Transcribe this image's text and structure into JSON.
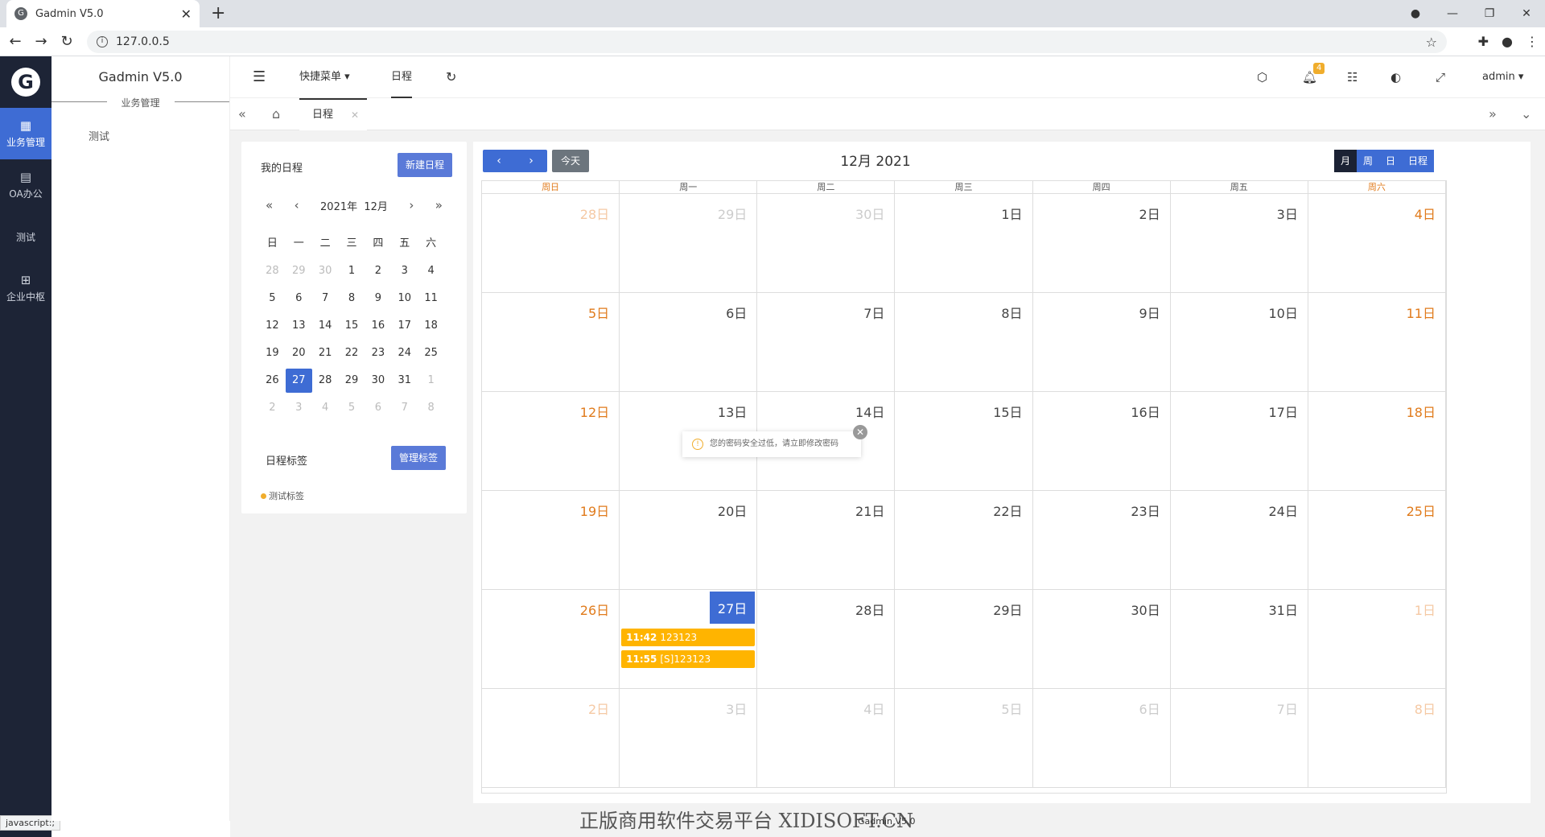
{
  "browser": {
    "tab_title": "Gadmin V5.0",
    "url": "127.0.0.5",
    "status_hint": "javascript:;"
  },
  "sidebar": {
    "items": [
      {
        "icon": "grid-icon",
        "label": "业务管理",
        "active": true
      },
      {
        "icon": "document-icon",
        "label": "OA办公"
      },
      {
        "icon": "none",
        "label": "测试"
      },
      {
        "icon": "apps-icon",
        "label": "企业中枢"
      }
    ]
  },
  "submenu": {
    "app_name": "Gadmin V5.0",
    "section": "业务管理",
    "items": [
      "测试"
    ]
  },
  "topbar": {
    "quick_menu": "快捷菜单",
    "schedule": "日程",
    "notification_count": "4",
    "user": "admin"
  },
  "tabs": {
    "current": "日程"
  },
  "left_panel": {
    "title": "我的日程",
    "new_button": "新建日程",
    "mini_year": "2021年",
    "mini_month": "12月",
    "weekdays": [
      "日",
      "一",
      "二",
      "三",
      "四",
      "五",
      "六"
    ],
    "weeks": [
      [
        "28",
        "29",
        "30",
        "1",
        "2",
        "3",
        "4"
      ],
      [
        "5",
        "6",
        "7",
        "8",
        "9",
        "10",
        "11"
      ],
      [
        "12",
        "13",
        "14",
        "15",
        "16",
        "17",
        "18"
      ],
      [
        "19",
        "20",
        "21",
        "22",
        "23",
        "24",
        "25"
      ],
      [
        "26",
        "27",
        "28",
        "29",
        "30",
        "31",
        "1"
      ],
      [
        "2",
        "3",
        "4",
        "5",
        "6",
        "7",
        "8"
      ]
    ],
    "tags_title": "日程标签",
    "manage_tags": "管理标签",
    "tag_name": "测试标签"
  },
  "calendar": {
    "title": "12月 2021",
    "today_button": "今天",
    "views": [
      "月",
      "周",
      "日",
      "日程"
    ],
    "active_view": "月",
    "day_headers": [
      "周日",
      "周一",
      "周二",
      "周三",
      "周四",
      "周五",
      "周六"
    ],
    "weeks": [
      [
        "28日",
        "29日",
        "30日",
        "1日",
        "2日",
        "3日",
        "4日"
      ],
      [
        "5日",
        "6日",
        "7日",
        "8日",
        "9日",
        "10日",
        "11日"
      ],
      [
        "12日",
        "13日",
        "14日",
        "15日",
        "16日",
        "17日",
        "18日"
      ],
      [
        "19日",
        "20日",
        "21日",
        "22日",
        "23日",
        "24日",
        "25日"
      ],
      [
        "26日",
        "27日",
        "28日",
        "29日",
        "30日",
        "31日",
        "1日"
      ],
      [
        "2日",
        "3日",
        "4日",
        "5日",
        "6日",
        "7日",
        "8日"
      ]
    ],
    "events": [
      {
        "time": "11:42",
        "title": "123123"
      },
      {
        "time": "11:55",
        "title": "[S]123123"
      }
    ],
    "event_color": "#ffb400"
  },
  "toast": {
    "message": "您的密码安全过低，请立即修改密码"
  },
  "footer": {
    "watermark": "正版商用软件交易平台 XIDISOFT.CN",
    "text": "Gadmin V5.0"
  }
}
